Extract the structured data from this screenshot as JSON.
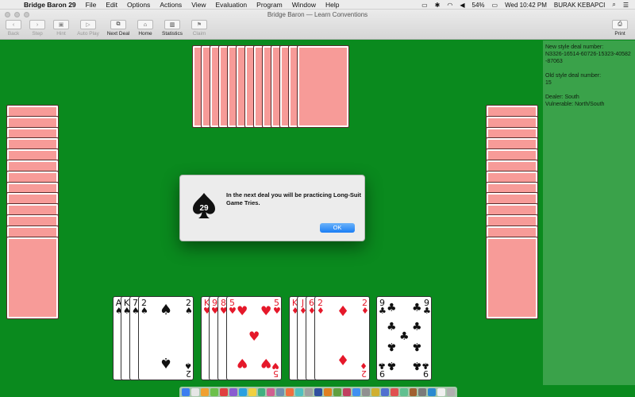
{
  "menubar": {
    "app_name": "Bridge Baron 29",
    "items": [
      "File",
      "Edit",
      "Options",
      "Actions",
      "View",
      "Evaluation",
      "Program",
      "Window",
      "Help"
    ],
    "battery": "54%",
    "clock": "Wed 10:42 PM",
    "user": "BURAK KEBAPCI"
  },
  "window": {
    "title": "Bridge Baron — Learn Conventions"
  },
  "toolbar": {
    "back": "Back",
    "step": "Step",
    "hint": "Hint",
    "auto_play": "Auto Play",
    "next_deal": "Next Deal",
    "home": "Home",
    "statistics": "Statistics",
    "claim": "Claim",
    "print": "Print"
  },
  "info_panel": {
    "new_style_label": "New style deal number:",
    "new_style_value": "N3326-16514-60726-15323-40582-87063",
    "old_style_label": "Old style deal number:",
    "old_style_value": "15",
    "dealer": "Dealer: South",
    "vulnerable": "Vulnerable: North/South"
  },
  "dialog": {
    "logo_number": "29",
    "message": "In the next deal you will be practicing Long-Suit Game Tries.",
    "ok_label": "OK"
  },
  "south_hand": {
    "spades": [
      "A",
      "K",
      "7",
      "2"
    ],
    "hearts": [
      "K",
      "9",
      "8",
      "5"
    ],
    "diamonds": [
      "K",
      "J",
      "6",
      "2"
    ],
    "clubs": [
      "9"
    ]
  },
  "colors": {
    "felt": "#0a8a1e",
    "panel": "#3aa24a",
    "card_back": "#f79b98"
  }
}
